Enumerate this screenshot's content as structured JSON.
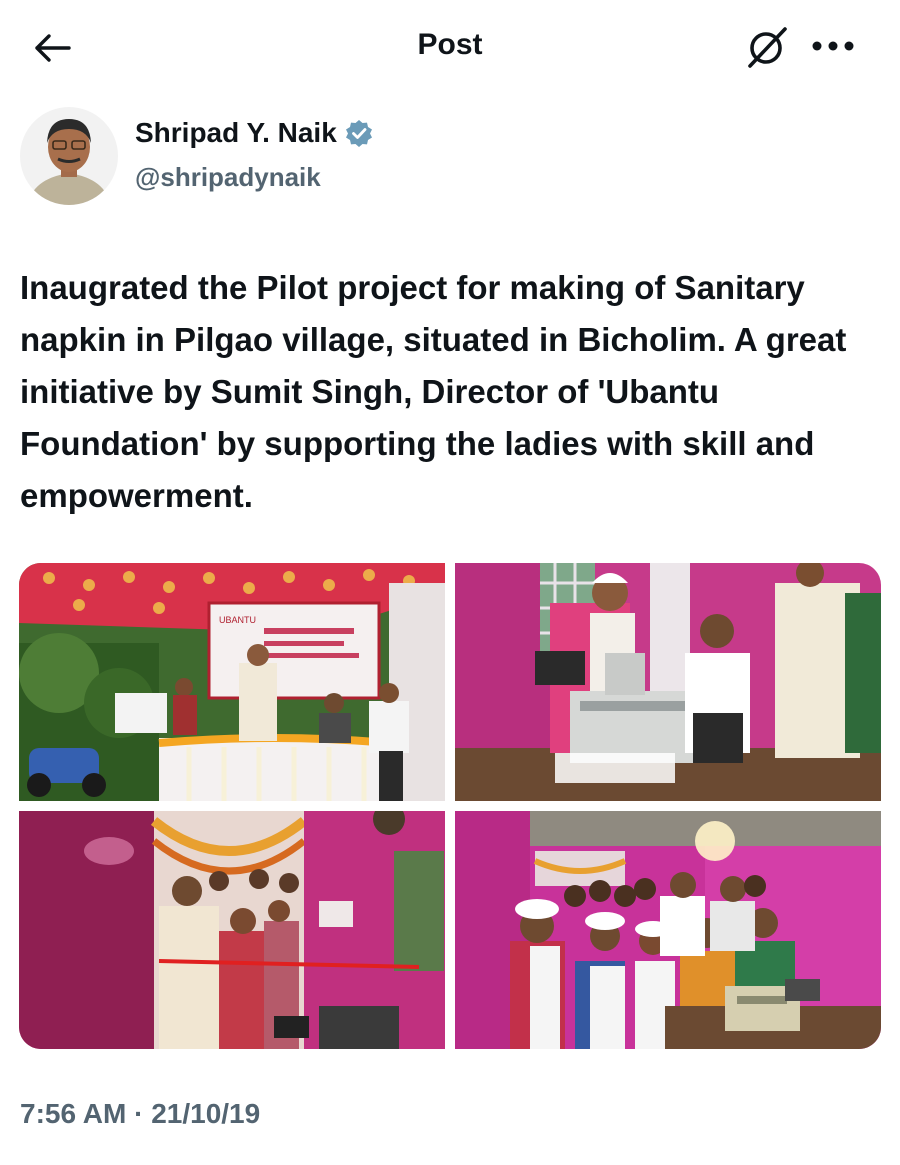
{
  "header": {
    "title": "Post",
    "icons": {
      "back": "arrow-left-icon",
      "grok": "grok-slash-icon",
      "more": "more-horizontal-icon"
    }
  },
  "author": {
    "name": "Shripad Y. Naik",
    "handle": "@shripadynaik",
    "verified": true,
    "verified_color": "#6b9bb8"
  },
  "post": {
    "text": "Inaugrated the Pilot project for making of Sanitary napkin in Pilgao village, situated in Bicholim. A great initiative by Sumit Singh, Director of 'Ubantu Foundation' by supporting the ladies with skill and empowerment.",
    "timestamp": "7:56 AM · 21/10/19"
  },
  "media": {
    "count": 4,
    "banner_text": "UBANTU",
    "photos": [
      "inauguration-stage-photo",
      "napkin-machine-demo-photo",
      "ribbon-cutting-photo",
      "group-with-machine-photo"
    ]
  },
  "colors": {
    "text": "#0f1419",
    "secondary": "#536471",
    "wall_pink": "#c0307f",
    "canopy_red": "#d8324a"
  }
}
